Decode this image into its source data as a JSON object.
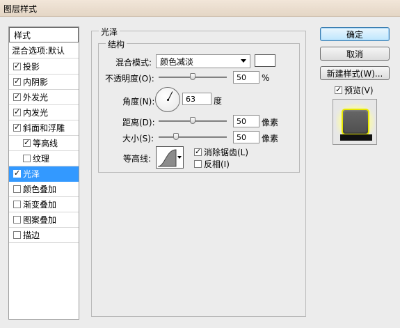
{
  "window": {
    "title": "图层样式"
  },
  "left_panel": {
    "header": "样式",
    "blend_options": "混合选项:默认",
    "items": [
      {
        "label": "投影",
        "checked": true,
        "indent": false,
        "selected": false
      },
      {
        "label": "内阴影",
        "checked": true,
        "indent": false,
        "selected": false
      },
      {
        "label": "外发光",
        "checked": true,
        "indent": false,
        "selected": false
      },
      {
        "label": "内发光",
        "checked": true,
        "indent": false,
        "selected": false
      },
      {
        "label": "斜面和浮雕",
        "checked": true,
        "indent": false,
        "selected": false
      },
      {
        "label": "等高线",
        "checked": true,
        "indent": true,
        "selected": false
      },
      {
        "label": "纹理",
        "checked": false,
        "indent": true,
        "selected": false
      },
      {
        "label": "光泽",
        "checked": true,
        "indent": false,
        "selected": true
      },
      {
        "label": "颜色叠加",
        "checked": false,
        "indent": false,
        "selected": false
      },
      {
        "label": "渐变叠加",
        "checked": false,
        "indent": false,
        "selected": false
      },
      {
        "label": "图案叠加",
        "checked": false,
        "indent": false,
        "selected": false
      },
      {
        "label": "描边",
        "checked": false,
        "indent": false,
        "selected": false
      }
    ]
  },
  "satin": {
    "group_title": "光泽",
    "structure_title": "结构",
    "blend_mode_label": "混合模式:",
    "blend_mode_value": "颜色减淡",
    "blend_color": "#ffffff",
    "opacity_label": "不透明度(O):",
    "opacity_value": "50",
    "opacity_unit": "%",
    "opacity_level": 0.5,
    "angle_label": "角度(N):",
    "angle_value": "63",
    "angle_unit": "度",
    "distance_label": "距离(D):",
    "distance_value": "50",
    "distance_unit": "像素",
    "distance_level": 0.5,
    "size_label": "大小(S):",
    "size_value": "50",
    "size_unit": "像素",
    "size_level": 0.25,
    "contour_label": "等高线:",
    "antialias_label": "消除锯齿(L)",
    "antialias_checked": true,
    "invert_label": "反相(I)",
    "invert_checked": false
  },
  "buttons": {
    "ok": "确定",
    "cancel": "取消",
    "new_style": "新建样式(W)...",
    "preview_label": "预览(V)",
    "preview_checked": true
  }
}
